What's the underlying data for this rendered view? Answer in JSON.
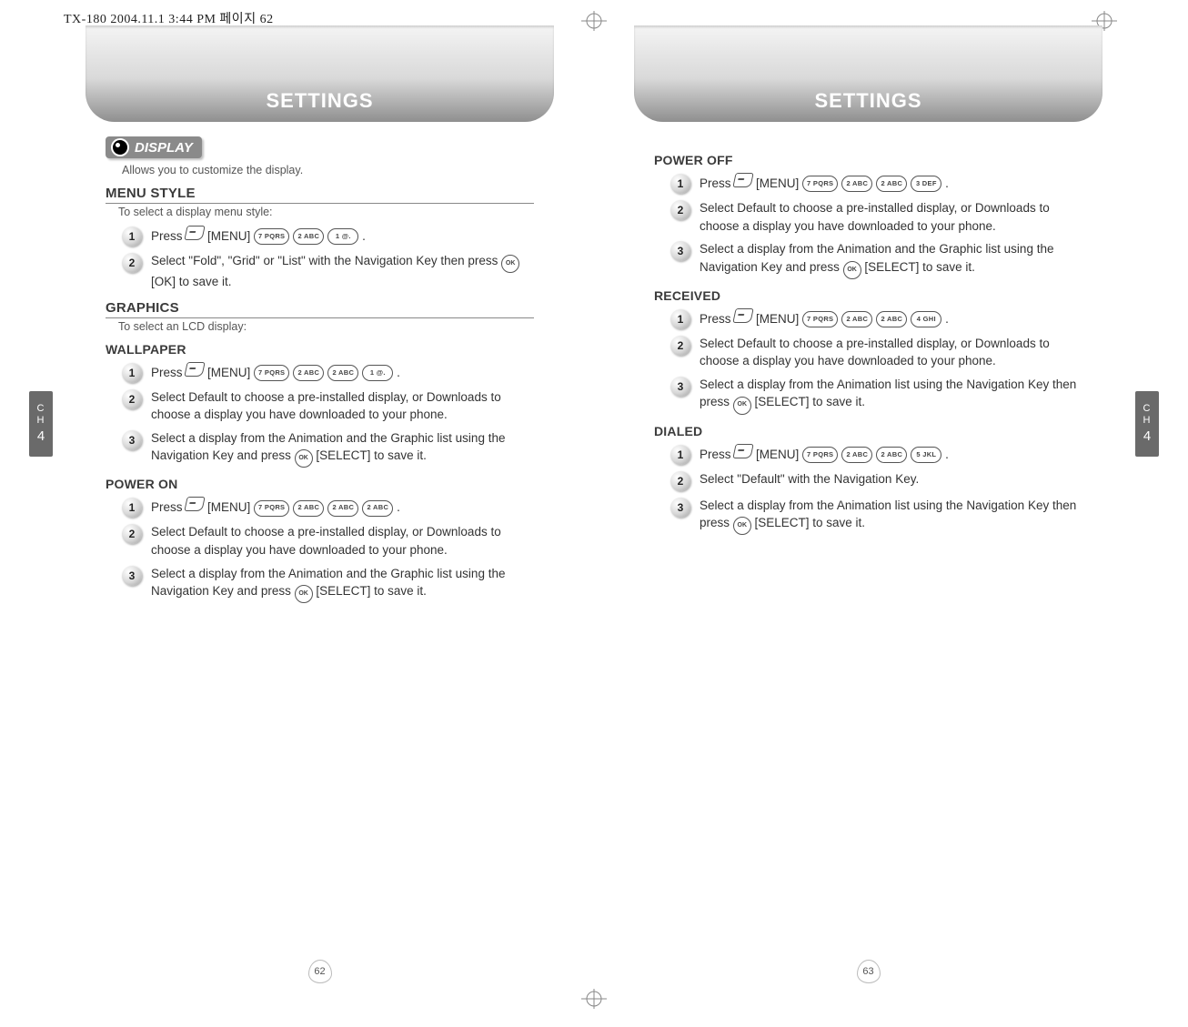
{
  "print_header": "TX-180  2004.11.1 3:44 PM  페이지 62",
  "chapter_tab": {
    "label_top": "C",
    "label_mid": "H",
    "number": "4"
  },
  "left": {
    "banner": "SETTINGS",
    "tag": "DISPLAY",
    "intro": "Allows you to customize the display.",
    "menu_style": {
      "heading": "MENU STYLE",
      "note": "To select a display menu style:",
      "steps": [
        {
          "n": "1",
          "pre": "Press ",
          "menu": "[MENU]",
          "keys": [
            "7 PQRS",
            "2 ABC",
            "1 @."
          ],
          "post": " ."
        },
        {
          "n": "2",
          "text": "Select \"Fold\", \"Grid\" or \"List\" with the Navigation Key then press ",
          "ok": true,
          "after": " [OK] to save it."
        }
      ]
    },
    "graphics": {
      "heading": "GRAPHICS",
      "note": "To select an LCD display:",
      "wallpaper": {
        "heading": "WALLPAPER",
        "steps": [
          {
            "n": "1",
            "pre": "Press ",
            "menu": "[MENU]",
            "keys": [
              "7 PQRS",
              "2 ABC",
              "2 ABC",
              "1 @."
            ],
            "post": " ."
          },
          {
            "n": "2",
            "text": "Select Default to choose a pre-installed display, or Downloads to choose a display you have downloaded to your phone."
          },
          {
            "n": "3",
            "text": "Select a display from the Animation and the Graphic list using the Navigation Key and press ",
            "ok": true,
            "after": " [SELECT] to save it."
          }
        ]
      },
      "power_on": {
        "heading": "POWER ON",
        "steps": [
          {
            "n": "1",
            "pre": "Press ",
            "menu": "[MENU]",
            "keys": [
              "7 PQRS",
              "2 ABC",
              "2 ABC",
              "2 ABC"
            ],
            "post": " ."
          },
          {
            "n": "2",
            "text": "Select Default to choose a pre-installed display, or Downloads to choose a display you have downloaded to your phone."
          },
          {
            "n": "3",
            "text": "Select a display from the Animation and the Graphic list using the Navigation Key and press ",
            "ok": true,
            "after": " [SELECT] to save it."
          }
        ]
      }
    },
    "page_number": "62"
  },
  "right": {
    "banner": "SETTINGS",
    "power_off": {
      "heading": "POWER OFF",
      "steps": [
        {
          "n": "1",
          "pre": "Press ",
          "menu": "[MENU]",
          "keys": [
            "7 PQRS",
            "2 ABC",
            "2 ABC",
            "3 DEF"
          ],
          "post": " ."
        },
        {
          "n": "2",
          "text": "Select Default to choose a pre-installed display, or Downloads to choose a display you have downloaded to your phone."
        },
        {
          "n": "3",
          "text": "Select a display from the Animation and the Graphic list using the Navigation Key and press ",
          "ok": true,
          "after": " [SELECT] to save it."
        }
      ]
    },
    "received": {
      "heading": "RECEIVED",
      "steps": [
        {
          "n": "1",
          "pre": "Press ",
          "menu": "[MENU]",
          "keys": [
            "7 PQRS",
            "2 ABC",
            "2 ABC",
            "4 GHI"
          ],
          "post": " ."
        },
        {
          "n": "2",
          "text": "Select Default to choose a pre-installed display, or Downloads to choose a display you have downloaded to your phone."
        },
        {
          "n": "3",
          "text": "Select a display from the Animation list using the Navigation Key then press ",
          "ok": true,
          "after": " [SELECT] to save it."
        }
      ]
    },
    "dialed": {
      "heading": "DIALED",
      "steps": [
        {
          "n": "1",
          "pre": "Press ",
          "menu": "[MENU]",
          "keys": [
            "7 PQRS",
            "2 ABC",
            "2 ABC",
            "5 JKL"
          ],
          "post": " ."
        },
        {
          "n": "2",
          "text": "Select \"Default\" with the Navigation Key."
        },
        {
          "n": "3",
          "text": "Select a display from the Animation list using the Navigation Key then press ",
          "ok": true,
          "after": " [SELECT] to save it."
        }
      ]
    },
    "page_number": "63"
  }
}
